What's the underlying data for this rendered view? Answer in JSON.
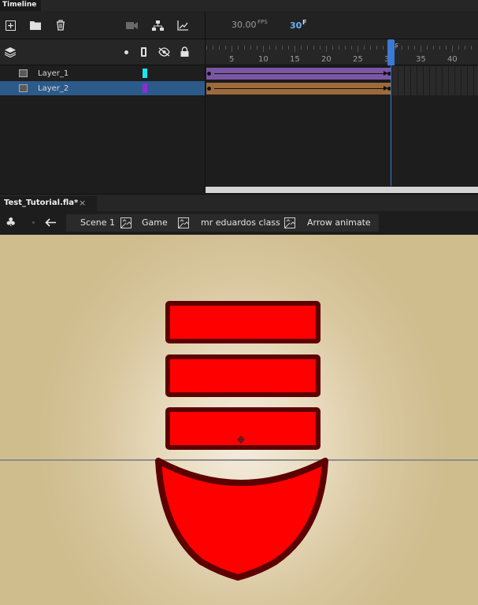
{
  "timeline": {
    "tab_label": "Timeline",
    "fps_value": "30.00",
    "fps_unit": "FPS",
    "current_frame": "30",
    "frame_unit": "F",
    "ruler_labels": [
      "5",
      "10",
      "15",
      "20",
      "25",
      "30",
      "35",
      "40"
    ],
    "ruler_marker": "s",
    "layers": [
      {
        "name": "Layer_1",
        "color": "#19e6ef",
        "span_color": "#7a56a5",
        "selected": false
      },
      {
        "name": "Layer_2",
        "color": "#8f2bd6",
        "span_color": "#9c6a3b",
        "selected": true
      }
    ]
  },
  "document": {
    "tab_label": "Test_Tutorial.fla*",
    "close_glyph": "×"
  },
  "breadcrumb": [
    "Scene 1",
    "Game",
    "mr eduardos class",
    "Arrow animate"
  ],
  "colors": {
    "accent": "#3a7bd5",
    "shape_fill": "#ff0000",
    "shape_stroke": "#5c0000",
    "selected_row": "#2c5a8a"
  }
}
